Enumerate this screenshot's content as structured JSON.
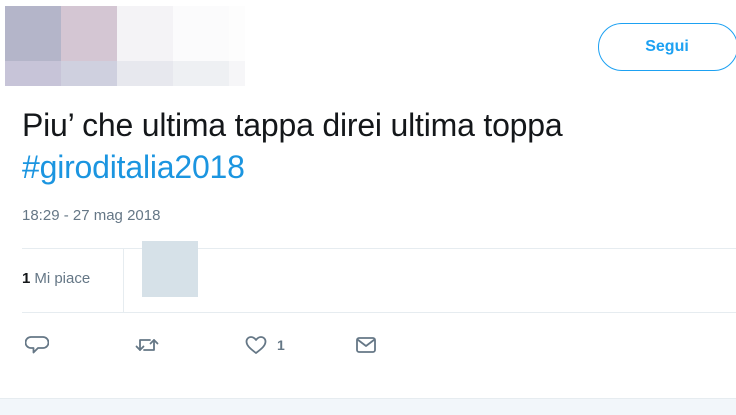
{
  "header": {
    "follow_label": "Segui"
  },
  "tweet": {
    "text": "Piu’ che ultima tappa direi ultima toppa",
    "hashtag": "#giroditalia2018",
    "timestamp": "18:29 - 27 mag 2018"
  },
  "stats": {
    "likes_count": "1",
    "likes_label": "Mi piace"
  },
  "actions": {
    "like_count": "1"
  },
  "icons": {
    "reply": "reply-icon",
    "retweet": "retweet-icon",
    "like": "heart-icon",
    "message": "envelope-icon"
  },
  "colors": {
    "accent": "#1da1f2",
    "hashtag": "#1b95e0",
    "muted": "#657786",
    "text": "#14171a",
    "divider": "#e6ecf0"
  }
}
